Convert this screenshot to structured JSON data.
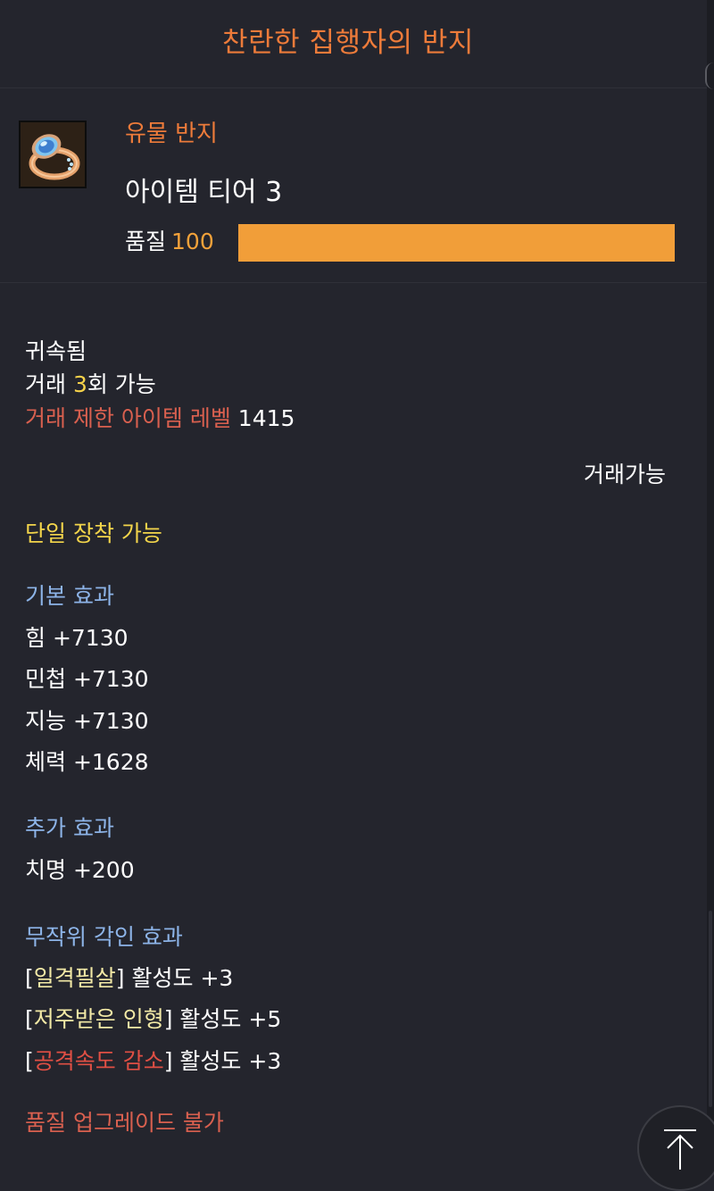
{
  "header": {
    "title": "찬란한 집행자의 반지"
  },
  "item": {
    "icon": "ring-icon",
    "grade_label": "유물 반지",
    "tier_label": "아이템 티어 3",
    "quality_label": "품질",
    "quality_value": "100",
    "quality_fraction": 1.0,
    "quality_color": "#f19e39"
  },
  "trade": {
    "bound": "귀속됨",
    "trade_prefix": "거래 ",
    "trade_count": "3",
    "trade_suffix": "회 가능",
    "restrict_label": "거래 제한 아이템 레벨",
    "restrict_level": "1415",
    "tradable": "거래가능"
  },
  "equip_note": "단일 장착 가능",
  "base_effects": {
    "title": "기본 효과",
    "items": [
      "힘 +7130",
      "민첩 +7130",
      "지능 +7130",
      "체력 +1628"
    ]
  },
  "extra_effects": {
    "title": "추가 효과",
    "items": [
      "치명 +200"
    ]
  },
  "engravings": {
    "title": "무작위 각인 효과",
    "items": [
      {
        "open": "[",
        "name": "일격필살",
        "close": "]",
        "value": " 활성도 +3",
        "type": "positive"
      },
      {
        "open": "[",
        "name": "저주받은 인형",
        "close": "]",
        "value": " 활성도 +5",
        "type": "positive"
      },
      {
        "open": "[",
        "name": "공격속도 감소",
        "close": "]",
        "value": " 활성도 +3",
        "type": "negative"
      }
    ]
  },
  "upgrade_note": "품질 업그레이드 불가",
  "fab": {
    "icon": "scroll-top-icon"
  },
  "colors": {
    "background": "#24252d",
    "title_orange": "#ed7b3a",
    "quality_bar": "#f19e39",
    "section_blue": "#8db4e8",
    "note_yellow": "#f3d54b",
    "warning_red": "#e04f44"
  }
}
